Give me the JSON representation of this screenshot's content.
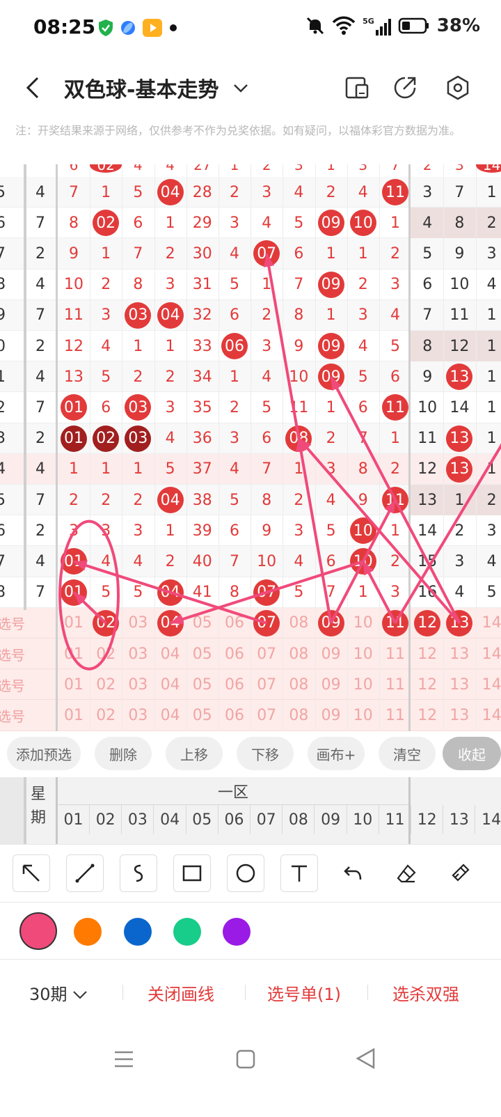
{
  "status": {
    "time": "08:25",
    "battery": "38%",
    "network": "5G"
  },
  "header": {
    "title": "双色球-基本走势"
  },
  "note": "注：开奖结果来源于网络，仅供参考不作为兑奖依据。如有疑问，以福体彩官方数据为准。",
  "board": {
    "left_col1": [
      "5",
      "6",
      "7",
      "8",
      "9",
      "0",
      "1",
      "2",
      "3",
      "4",
      "5",
      "6",
      "7",
      "8"
    ],
    "left_col2": [
      "4",
      "7",
      "2",
      "4",
      "7",
      "2",
      "4",
      "7",
      "2",
      "4",
      "7",
      "2",
      "4",
      "7"
    ],
    "rows": [
      [
        "7",
        "1",
        "5",
        "04",
        "28",
        "2",
        "3",
        "4",
        "2",
        "4",
        "11",
        "3",
        "7",
        "1"
      ],
      [
        "8",
        "02",
        "6",
        "1",
        "29",
        "3",
        "4",
        "5",
        "09",
        "10",
        "1",
        "4",
        "8",
        "2"
      ],
      [
        "9",
        "1",
        "7",
        "2",
        "30",
        "4",
        "07",
        "6",
        "1",
        "1",
        "2",
        "5",
        "9",
        "3"
      ],
      [
        "10",
        "2",
        "8",
        "3",
        "31",
        "5",
        "1",
        "7",
        "09",
        "2",
        "3",
        "6",
        "10",
        "4"
      ],
      [
        "11",
        "3",
        "03",
        "04",
        "32",
        "6",
        "2",
        "8",
        "1",
        "3",
        "4",
        "7",
        "11",
        "1"
      ],
      [
        "12",
        "4",
        "1",
        "1",
        "33",
        "06",
        "3",
        "9",
        "09",
        "4",
        "5",
        "8",
        "12",
        "1"
      ],
      [
        "13",
        "5",
        "2",
        "2",
        "34",
        "1",
        "4",
        "10",
        "09",
        "5",
        "6",
        "9",
        "13",
        "1"
      ],
      [
        "01",
        "6",
        "03",
        "3",
        "35",
        "2",
        "5",
        "11",
        "1",
        "6",
        "11",
        "10",
        "14",
        "1"
      ],
      [
        "01",
        "02",
        "03",
        "4",
        "36",
        "3",
        "6",
        "08",
        "2",
        "7",
        "1",
        "11",
        "13",
        "1"
      ],
      [
        "1",
        "1",
        "1",
        "5",
        "37",
        "4",
        "7",
        "1",
        "3",
        "8",
        "2",
        "12",
        "13",
        "1"
      ],
      [
        "2",
        "2",
        "2",
        "04",
        "38",
        "5",
        "8",
        "2",
        "4",
        "9",
        "11",
        "13",
        "1",
        "2"
      ],
      [
        "3",
        "3",
        "3",
        "1",
        "39",
        "6",
        "9",
        "3",
        "5",
        "10",
        "1",
        "14",
        "2",
        "3"
      ],
      [
        "01",
        "4",
        "4",
        "2",
        "40",
        "7",
        "10",
        "4",
        "6",
        "10",
        "2",
        "15",
        "3",
        "4"
      ],
      [
        "01",
        "5",
        "5",
        "04",
        "41",
        "8",
        "07",
        "5",
        "7",
        "1",
        "3",
        "16",
        "4",
        "5"
      ]
    ],
    "pick_label": "选号",
    "pick_numbers": [
      "01",
      "02",
      "03",
      "04",
      "05",
      "06",
      "07",
      "08",
      "09",
      "10",
      "11",
      "12",
      "13",
      "14"
    ],
    "selected": [
      "02",
      "04",
      "07",
      "09",
      "11",
      "12",
      "13"
    ]
  },
  "actions": [
    "添加预选",
    "删除",
    "上移",
    "下移",
    "画布+",
    "清空",
    "收起"
  ],
  "table_header": {
    "week_label": "星期",
    "zone_label": "一区",
    "numbers": [
      "01",
      "02",
      "03",
      "04",
      "05",
      "06",
      "07",
      "08",
      "09",
      "10",
      "11",
      "12",
      "13",
      "14"
    ]
  },
  "colors": [
    "#f04a7a",
    "#ff7a00",
    "#0a66cc",
    "#18cc8a",
    "#9a1ae6"
  ],
  "bottom": {
    "period": "30期",
    "close_draw": "关闭画线",
    "pick_list": "选号单(1)",
    "kill": "选杀双强"
  }
}
